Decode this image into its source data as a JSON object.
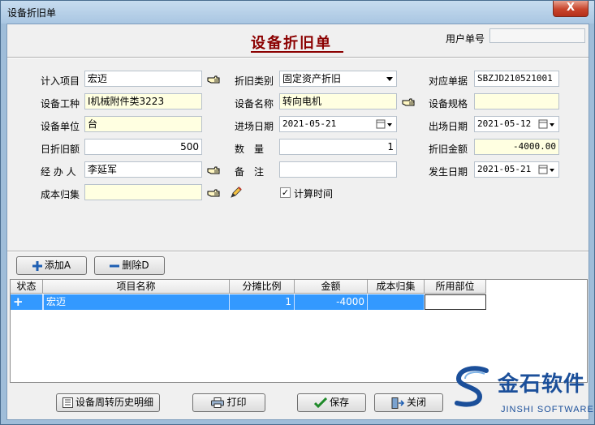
{
  "window": {
    "title": "设备折旧单",
    "close_label": "X"
  },
  "form": {
    "title": "设备折旧单",
    "user_no_label": "用户单号",
    "user_no_value": ""
  },
  "fields": {
    "jiru_xiangmu": {
      "label": "计入项目",
      "value": "宏迈"
    },
    "zhejiu_leibie": {
      "label": "折旧类别",
      "value": "固定资产折旧"
    },
    "duiying_danju": {
      "label": "对应单据",
      "value": "SBZJD210521001"
    },
    "shebei_gongzhong": {
      "label": "设备工种",
      "value": "I机械附件类3223"
    },
    "shebei_mingcheng": {
      "label": "设备名称",
      "value": "转向电机"
    },
    "shebei_guige": {
      "label": "设备规格",
      "value": ""
    },
    "shebei_danwei": {
      "label": "设备单位",
      "value": "台"
    },
    "jinchang_riqi": {
      "label": "进场日期",
      "value": "2021-05-21"
    },
    "chuchang_riqi": {
      "label": "出场日期",
      "value": "2021-05-12"
    },
    "ri_zhejiu_e": {
      "label": "日折旧额",
      "value": "500"
    },
    "shuliang": {
      "label": "数　量",
      "value": "1"
    },
    "zhejiu_jine": {
      "label": "折旧金额",
      "value": "-4000.00"
    },
    "jingbanren": {
      "label": "经 办 人",
      "value": "李延军"
    },
    "beizhu": {
      "label": "备　注",
      "value": ""
    },
    "fasheng_riqi": {
      "label": "发生日期",
      "value": "2021-05-21"
    },
    "chengben_guiji": {
      "label": "成本归集",
      "value": ""
    },
    "jisuan_shijian": {
      "label": "计算时间",
      "checked": true
    }
  },
  "toolbar": {
    "add_label": "添加A",
    "delete_label": "删除D"
  },
  "table": {
    "columns": [
      "状态",
      "项目名称",
      "分摊比例",
      "金额",
      "成本归集",
      "所用部位"
    ],
    "rows": [
      {
        "status": "+",
        "name": "宏迈",
        "ratio": "1",
        "amount": "-4000",
        "cost": "",
        "part": ""
      }
    ]
  },
  "buttons": {
    "history_label": "设备周转历史明细",
    "print_label": "打印",
    "save_label": "保存",
    "close_label": "关闭"
  },
  "logo": {
    "cn": "金石软件",
    "en": "JINSHI SOFTWARE"
  },
  "colors": {
    "title_red": "#8b0000",
    "yellow_field": "#ffffe1",
    "selection": "#3399ff",
    "logo_blue": "#1b4f9a"
  }
}
